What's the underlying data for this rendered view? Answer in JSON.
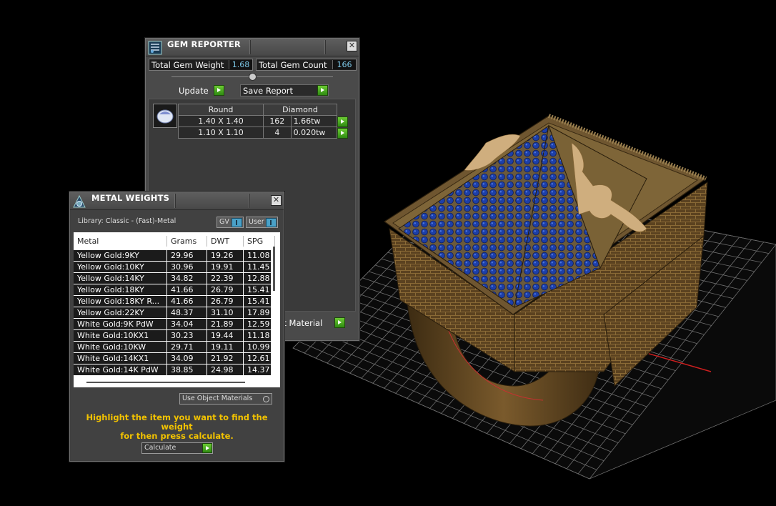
{
  "gem_reporter": {
    "title": "GEM REPORTER",
    "close_glyph": "✕",
    "total_weight_label": "Total Gem Weight",
    "total_weight_value": "1.68",
    "total_count_label": "Total Gem Count",
    "total_count_value": "166",
    "update_label": "Update",
    "save_report_label": "Save Report",
    "set_material_label": "Set Material",
    "gem_table": {
      "headers": [
        "Round",
        "Diamond"
      ],
      "rows": [
        {
          "size": "1.40 X 1.40",
          "count": "162",
          "weight": "1.66tw"
        },
        {
          "size": "1.10 X 1.10",
          "count": "4",
          "weight": "0.020tw"
        }
      ]
    },
    "icons": [
      "gem-reporter-icon",
      "gem-shape-icon",
      "play-icon"
    ]
  },
  "metal_weights": {
    "title": "METAL WEIGHTS",
    "close_glyph": "✕",
    "library_label": "Library: Classic - (Fast)-Metal",
    "gv_label": "GV",
    "user_label": "User",
    "columns": [
      "Metal",
      "Grams",
      "DWT",
      "SPG"
    ],
    "rows": [
      [
        "Yellow Gold:9KY",
        "29.96",
        "19.26",
        "11.08"
      ],
      [
        "Yellow Gold:10KY",
        "30.96",
        "19.91",
        "11.45"
      ],
      [
        "Yellow Gold:14KY",
        "34.82",
        "22.39",
        "12.88"
      ],
      [
        "Yellow Gold:18KY",
        "41.66",
        "26.79",
        "15.41"
      ],
      [
        "Yellow Gold:18KY R...",
        "41.66",
        "26.79",
        "15.41"
      ],
      [
        "Yellow Gold:22KY",
        "48.37",
        "31.10",
        "17.89"
      ],
      [
        "White Gold:9K PdW",
        "34.04",
        "21.89",
        "12.59"
      ],
      [
        "White Gold:10KX1",
        "30.23",
        "19.44",
        "11.18"
      ],
      [
        "White Gold:10KW",
        "29.71",
        "19.11",
        "10.99"
      ],
      [
        "White Gold:14KX1",
        "34.09",
        "21.92",
        "12.61"
      ],
      [
        "White Gold:14K PdW",
        "38.85",
        "24.98",
        "14.37"
      ]
    ],
    "use_object_materials_label": "Use Object Materials",
    "hint_line1": "Highlight the item you want to find the weight",
    "hint_line2": "for then press calculate.",
    "calculate_label": "Calculate",
    "icons": [
      "metal-weights-icon",
      "play-icon"
    ]
  },
  "viewport": {
    "background": "#000000",
    "grid_color": "#6e6e6e",
    "axis_color": "#cc1f1f",
    "ring_metal_color": "#6b4e23",
    "gem_color": "#1d3fa8",
    "prong_color": "#c9a679"
  }
}
